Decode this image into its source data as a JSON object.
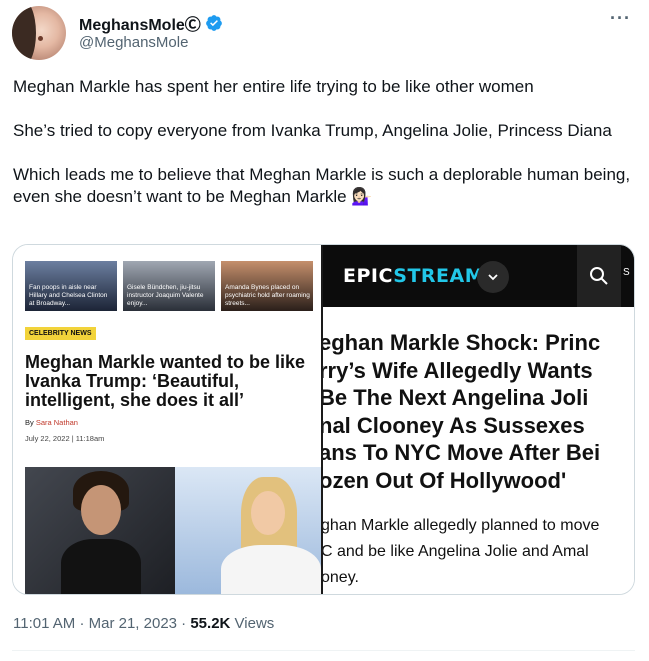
{
  "author": {
    "display_name": "MeghansMoleⒸ",
    "handle": "@MeghansMole",
    "verified": true
  },
  "tweet": {
    "paragraphs": [
      "Meghan Markle has spent her entire life trying to be like other women",
      "She’s tried to copy everyone from Ivanka Trump, Angelina Jolie, Princess Diana",
      "Which leads me to believe that Meghan Markle is such a deplorable human being, even she doesn’t want to be Meghan Markle 💁🏻‍♀️"
    ],
    "time": "11:01 AM",
    "date": "Mar 21, 2023",
    "views_count": "55.2K",
    "views_label": "Views"
  },
  "left_screenshot": {
    "thumbnails": [
      "Fan poops in aisle near Hillary and Chelsea Clinton at Broadway...",
      "Gisele Bündchen, jiu-jitsu instructor Joaquim Valente enjoy...",
      "Amanda Bynes placed on psychiatric hold after roaming streets..."
    ],
    "tag": "CELEBRITY NEWS",
    "headline": "Meghan Markle wanted to be like Ivanka Trump: ‘Beautiful, intelligent, she does it all’",
    "byline_prefix": "By ",
    "author": "Sara Nathan",
    "date": "July 22, 2022 | 11:18am"
  },
  "right_screenshot": {
    "logo_part1": "EPIC",
    "logo_part2": "STREAM",
    "edge_char": "S",
    "title_lines": [
      "eghan Markle Shock: Princ",
      "rry’s Wife Allegedly Wants",
      " Be The Next Angelina Joli",
      "nal Clooney As Sussexes",
      "ans To NYC Move After Bei",
      "ozen Out Of Hollywood'"
    ],
    "excerpt_lines": [
      "ghan Markle allegedly planned to move",
      "C and be like Angelina Jolie and Amal",
      "oney."
    ]
  },
  "colors": {
    "verified_blue": "#1d9bf0",
    "epicstream_accent": "#22c7e8",
    "tag_yellow": "#f2d33a",
    "secondary_text": "#536471"
  },
  "icons": [
    "verified-badge-icon",
    "more-options-icon",
    "chevron-down-icon",
    "search-icon"
  ]
}
